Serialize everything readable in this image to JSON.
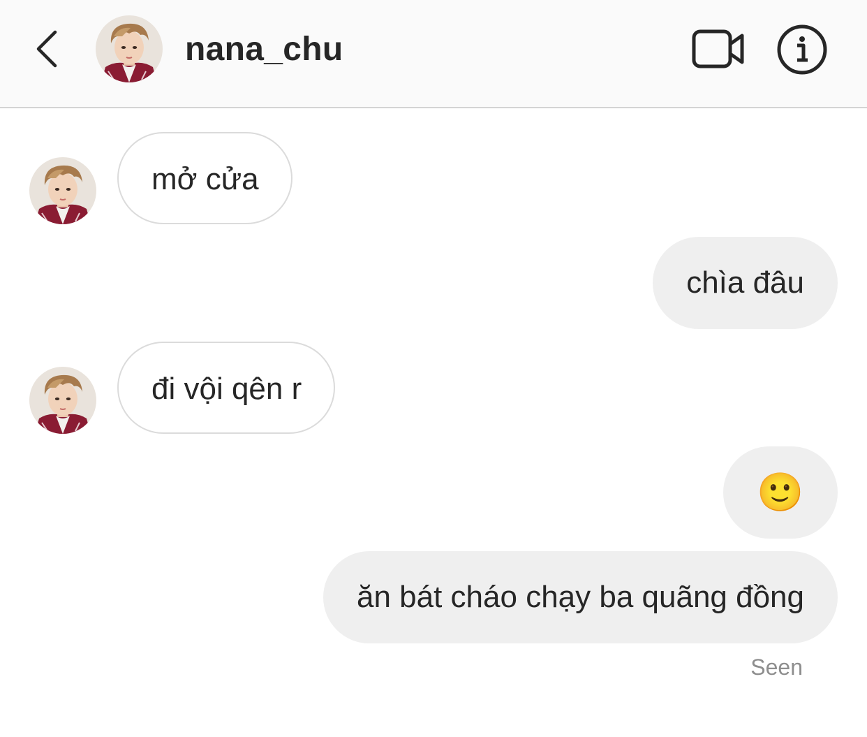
{
  "header": {
    "username": "nana_chu"
  },
  "messages": [
    {
      "direction": "incoming",
      "text": "mở cửa"
    },
    {
      "direction": "outgoing",
      "text": "chìa đâu"
    },
    {
      "direction": "incoming",
      "text": "đi vội qên r"
    },
    {
      "direction": "outgoing",
      "text": "🙂"
    },
    {
      "direction": "outgoing",
      "text": "ăn bát cháo chạy ba quãng đồng"
    }
  ],
  "status": {
    "seen": "Seen"
  },
  "colors": {
    "header_bg": "#fafafa",
    "incoming_bubble": "#ffffff",
    "outgoing_bubble": "#efefef",
    "text": "#262626",
    "muted": "#8e8e8e"
  },
  "icons": {
    "back": "chevron-left-icon",
    "video": "video-camera-icon",
    "info": "info-icon"
  }
}
